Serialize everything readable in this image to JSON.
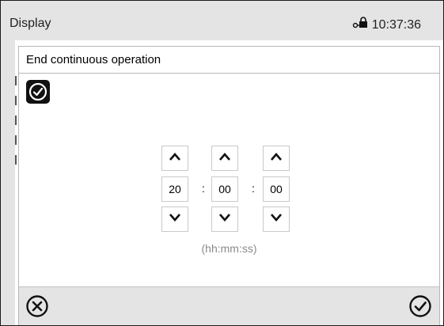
{
  "header": {
    "title": "Display",
    "time": "10:37:36",
    "lock_icon": "lock-key-icon"
  },
  "dialog": {
    "title": "End continuous operation",
    "header_icon": "clock-icon",
    "time_input": {
      "hours": "20",
      "minutes": "00",
      "seconds": "00",
      "separator": ":",
      "format_hint": "(hh:mm:ss)"
    },
    "up_icon": "chevron-up-icon",
    "down_icon": "chevron-down-icon",
    "cancel_icon": "cancel-circle-x-icon",
    "confirm_icon": "confirm-circle-check-icon"
  },
  "colors": {
    "bar_background": "#e4e4e4",
    "panel_background": "#ffffff",
    "hint_text": "#8a8a8a",
    "button_border": "#c9c9c9"
  }
}
